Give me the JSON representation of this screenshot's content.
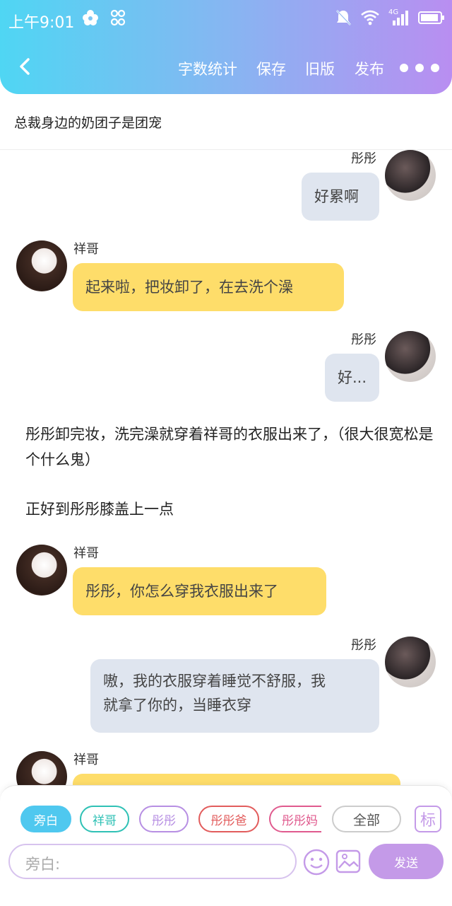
{
  "status": {
    "time": "上午9:01",
    "network": "4G"
  },
  "toolbar": {
    "word_count": "字数统计",
    "save": "保存",
    "old_version": "旧版",
    "publish": "发布"
  },
  "title": "总裁身边的奶团子是团宠",
  "messages": [
    {
      "side": "right",
      "name": "彤彤",
      "text": "好累啊"
    },
    {
      "side": "left",
      "name": "祥哥",
      "text": "起来啦，把妆卸了，在去洗个澡"
    },
    {
      "side": "right",
      "name": "彤彤",
      "text": "好..."
    },
    {
      "narration_1": "彤彤卸完妆，洗完澡就穿着祥哥的衣服出来了，（很大很宽松是个什么鬼）",
      "narration_2": "正好到彤彤膝盖上一点"
    },
    {
      "side": "left",
      "name": "祥哥",
      "text": "彤彤，你怎么穿我衣服出来了"
    },
    {
      "side": "right",
      "name": "彤彤",
      "text_line1": "嗷，我的衣服穿着睡觉不舒服，我",
      "text_line2": "就拿了你的，当睡衣穿"
    },
    {
      "side": "left",
      "name": "祥哥",
      "text": ""
    }
  ],
  "roles": [
    {
      "label": "旁白",
      "color": "#4fc8ef",
      "selected": true
    },
    {
      "label": "祥哥",
      "color": "#2fc1b5"
    },
    {
      "label": "彤彤",
      "color": "#b78fe3"
    },
    {
      "label": "彤彤爸",
      "color": "#e25c5c"
    },
    {
      "label": "彤彤妈",
      "color": "#e05a8e"
    },
    {
      "label": "全部",
      "color": "#cccccc"
    }
  ],
  "mark_button": "标",
  "input": {
    "placeholder": "旁白:"
  },
  "send_label": "发送",
  "colors": {
    "header_start": "#4fd6f3",
    "header_end": "#b98ef1",
    "bubble_me": "#dfe5ef",
    "bubble_other": "#fedd6a",
    "accent": "#c49ae8"
  }
}
